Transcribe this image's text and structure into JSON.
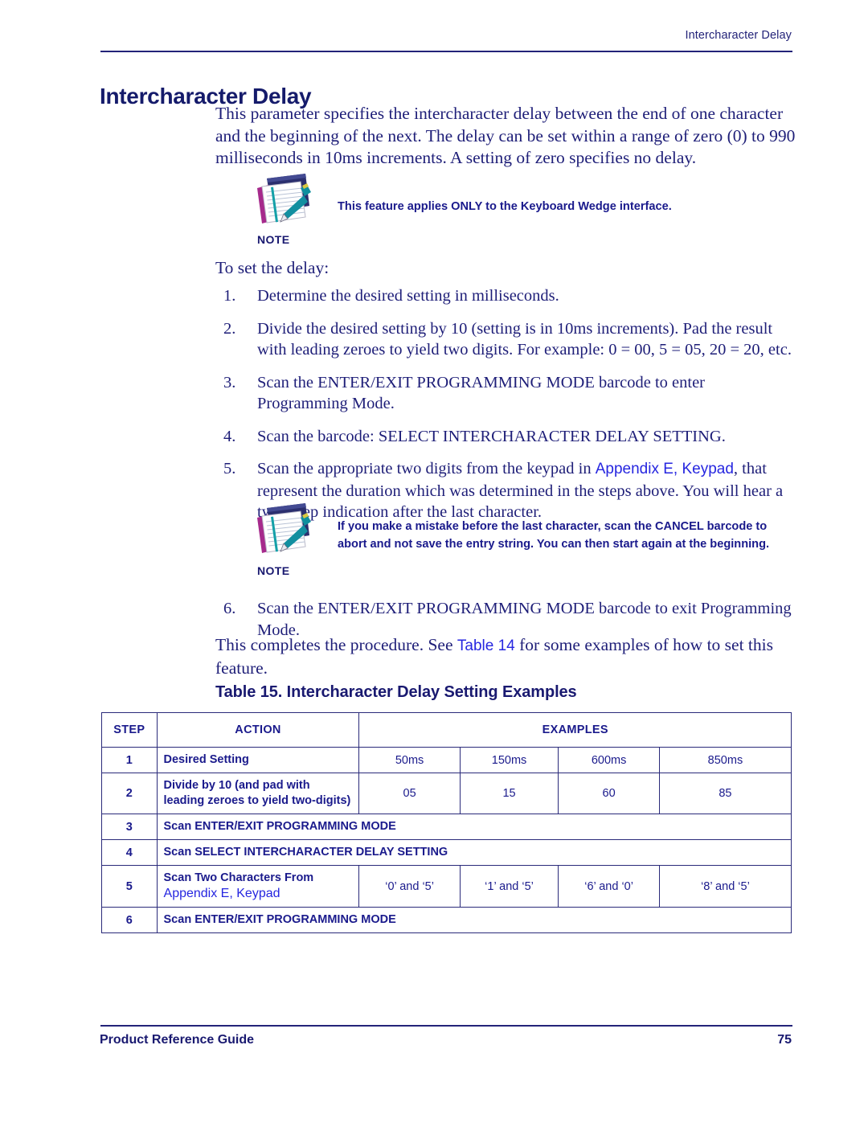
{
  "page": {
    "running_header": "Intercharacter Delay",
    "section_title": "Intercharacter Delay",
    "footer_left": "Product Reference Guide",
    "footer_page_number": "75"
  },
  "intro": {
    "paragraph": "This parameter specifies the intercharacter delay between the end of one character and the beginning of the next. The delay can be set within a range of zero (0) to 990 milliseconds in 10ms increments. A setting of zero specifies no delay."
  },
  "note1": {
    "label": "NOTE",
    "icon": "notepad-pencil-icon",
    "text": "This feature applies ONLY to the Keyboard Wedge interface."
  },
  "note2": {
    "label": "NOTE",
    "icon": "notepad-pencil-icon",
    "line1": "If you make a mistake before the last character, scan the CANCEL barcode to",
    "line2": "abort and not save the entry string. You can then start again at the beginning."
  },
  "procedure": {
    "lead": "To set the delay:",
    "steps": [
      {
        "num": "1.",
        "text": "Determine the desired setting in milliseconds."
      },
      {
        "num": "2.",
        "text": "Divide the desired setting by 10 (setting is in 10ms increments). Pad the result with leading zeroes to yield two digits. For example: 0 = 00, 5 = 05, 20 = 20, etc."
      },
      {
        "num": "3.",
        "text": "Scan the ENTER/EXIT PROGRAMMING MODE barcode to enter Programming Mode."
      },
      {
        "num": "4.",
        "text": "Scan the barcode: SELECT INTERCHARACTER DELAY SETTING."
      },
      {
        "num": "5.",
        "pre": "Scan the appropriate two digits from the keypad in ",
        "link": "Appendix E, Keypad",
        "post": ", that represent the duration which was determined in the steps above. You will hear a two-beep indication after the last character."
      },
      {
        "num": "6.",
        "text": "Scan the ENTER/EXIT PROGRAMMING MODE barcode to exit Programming Mode."
      }
    ],
    "closing_pre": "This completes the procedure. See ",
    "closing_link": "Table 14",
    "closing_post": " for some examples of how to set this feature."
  },
  "table": {
    "caption": "Table 15. Intercharacter Delay Setting Examples",
    "headers": {
      "step": "STEP",
      "action": "ACTION",
      "examples": "EXAMPLES"
    },
    "rows": [
      {
        "step": "1",
        "action": "Desired Setting",
        "examples": [
          "50ms",
          "150ms",
          "600ms",
          "850ms"
        ]
      },
      {
        "step": "2",
        "action": "Divide by 10 (and pad with leading zeroes to yield two-digits)",
        "examples": [
          "05",
          "15",
          "60",
          "85"
        ]
      },
      {
        "step": "3",
        "action": "Scan ENTER/EXIT PROGRAMMING MODE",
        "examples": []
      },
      {
        "step": "4",
        "action": "Scan SELECT INTERCHARACTER DELAY SETTING",
        "examples": []
      },
      {
        "step": "5",
        "action": "Scan Two Characters From",
        "action_link": "Appendix E, Keypad",
        "examples": [
          "‘0’ and ‘5’",
          "‘1’ and ‘5’",
          "‘6’ and ‘0’",
          "‘8’ and ‘5’"
        ]
      },
      {
        "step": "6",
        "action": "Scan ENTER/EXIT PROGRAMMING MODE",
        "examples": []
      }
    ]
  },
  "colors": {
    "navy": "#191970",
    "body_blue": "#1e1e78",
    "link_blue": "#2626e0",
    "rule": "#232379"
  }
}
